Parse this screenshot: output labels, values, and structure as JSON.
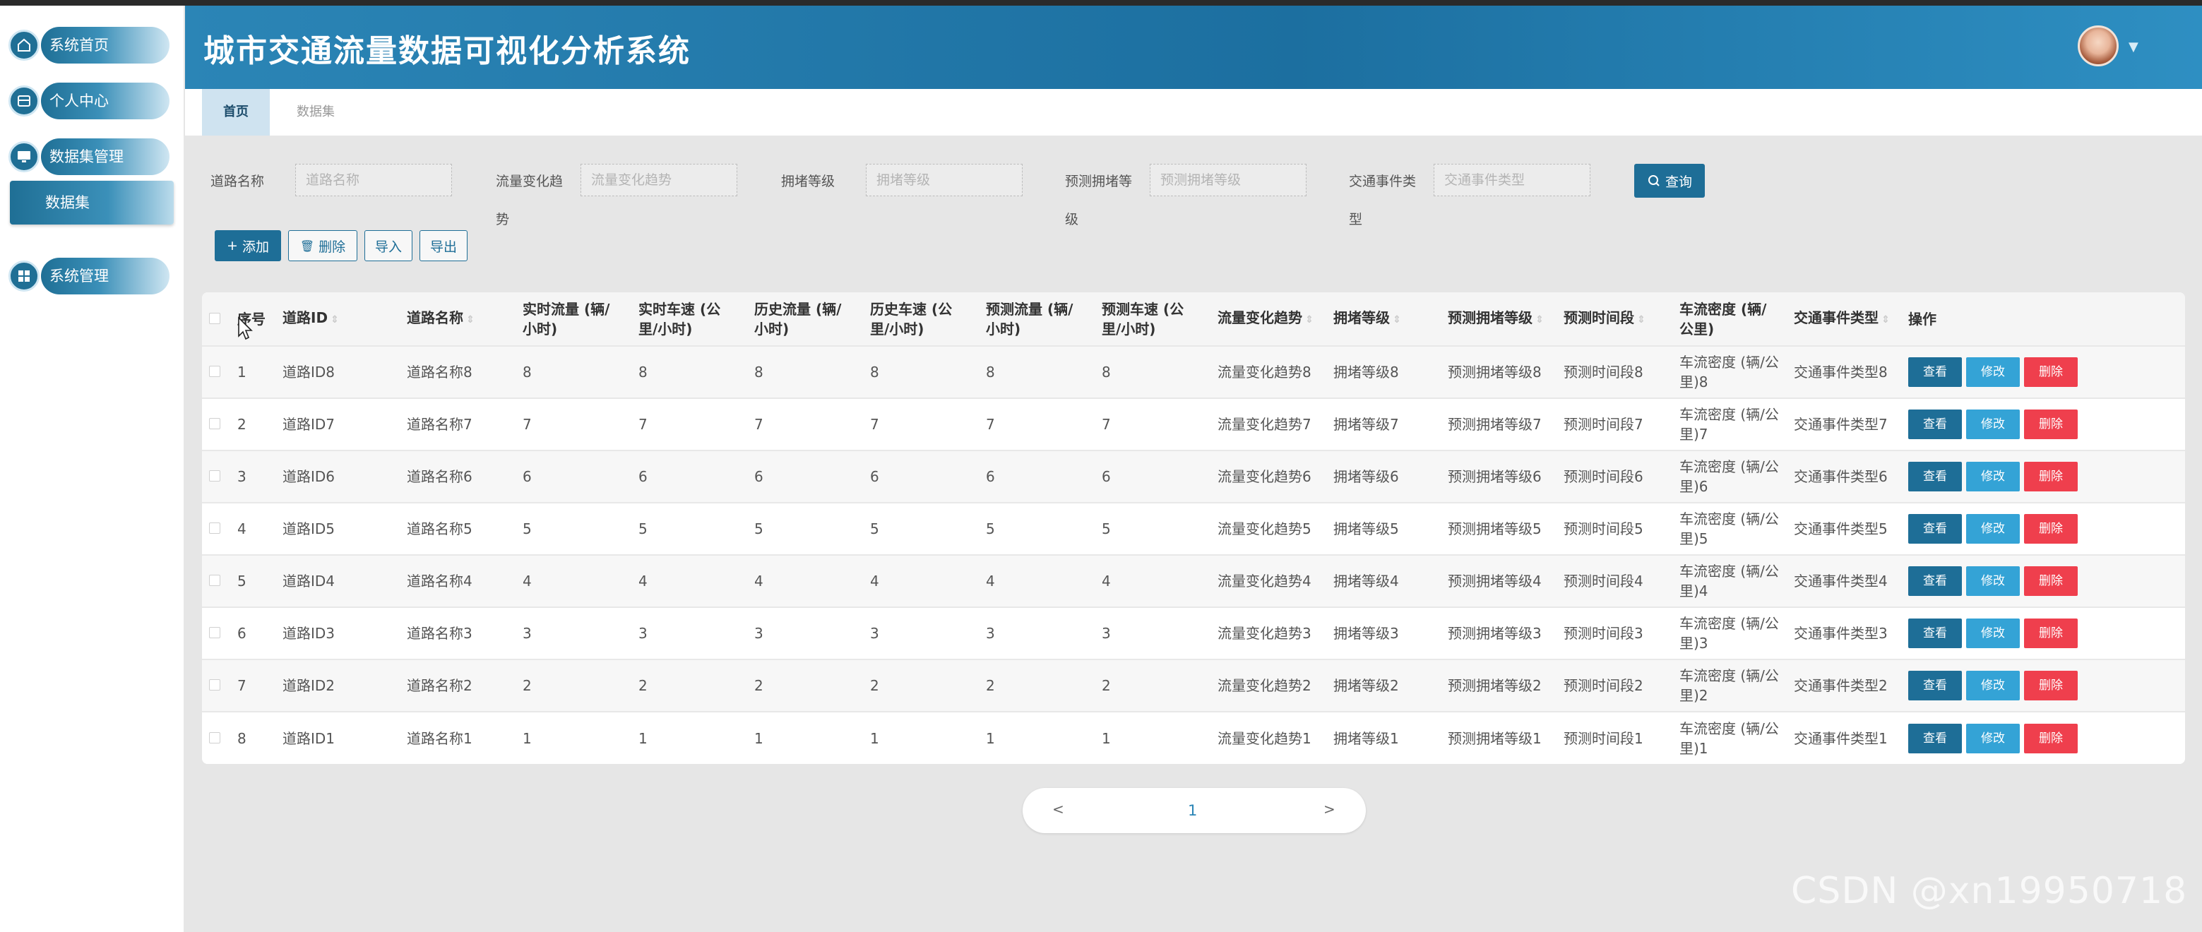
{
  "app": {
    "title": "城市交通流量数据可视化分析系统"
  },
  "sidebar": {
    "items": [
      {
        "label": "系统首页",
        "icon": "home-icon"
      },
      {
        "label": "个人中心",
        "icon": "profile-icon"
      },
      {
        "label": "数据集管理",
        "icon": "monitor-icon"
      },
      {
        "label": "系统管理",
        "icon": "grid-icon"
      }
    ],
    "sub_item": "数据集"
  },
  "tabs": [
    {
      "label": "首页",
      "active": true
    },
    {
      "label": "数据集",
      "active": false
    }
  ],
  "search": {
    "fields": [
      {
        "label_line1": "道路名称",
        "label_line2": "",
        "placeholder": "道路名称",
        "value": ""
      },
      {
        "label_line1": "流量变化趋",
        "label_line2": "势",
        "placeholder": "流量变化趋势",
        "value": ""
      },
      {
        "label_line1": "拥堵等级",
        "label_line2": "",
        "placeholder": "拥堵等级",
        "value": ""
      },
      {
        "label_line1": "预测拥堵等",
        "label_line2": "级",
        "placeholder": "预测拥堵等级",
        "value": ""
      },
      {
        "label_line1": "交通事件类",
        "label_line2": "型",
        "placeholder": "交通事件类型",
        "value": ""
      }
    ],
    "query_label": "查询"
  },
  "actions": {
    "add": "添加",
    "delete": "删除",
    "import": "导入",
    "export": "导出"
  },
  "table": {
    "columns": [
      {
        "line1": "序号",
        "line2": ""
      },
      {
        "line1": "道路ID",
        "line2": ""
      },
      {
        "line1": "道路名称",
        "line2": ""
      },
      {
        "line1": "实时流量 (辆/",
        "line2": "小时)"
      },
      {
        "line1": "实时车速 (公",
        "line2": "里/小时)"
      },
      {
        "line1": "历史流量 (辆/",
        "line2": "小时)"
      },
      {
        "line1": "历史车速 (公",
        "line2": "里/小时)"
      },
      {
        "line1": "预测流量 (辆/",
        "line2": "小时)"
      },
      {
        "line1": "预测车速 (公",
        "line2": "里/小时)"
      },
      {
        "line1": "流量变化趋势",
        "line2": ""
      },
      {
        "line1": "拥堵等级",
        "line2": ""
      },
      {
        "line1": "预测拥堵等级",
        "line2": ""
      },
      {
        "line1": "预测时间段",
        "line2": ""
      },
      {
        "line1": "车流密度 (辆/",
        "line2": "公里)"
      },
      {
        "line1": "交通事件类型",
        "line2": ""
      },
      {
        "line1": "操作",
        "line2": ""
      }
    ],
    "rows": [
      {
        "seq": "1",
        "road_id": "道路ID8",
        "road_name": "道路名称8",
        "rt_flow": "8",
        "rt_speed": "8",
        "hist_flow": "8",
        "hist_speed": "8",
        "pred_flow": "8",
        "pred_speed": "8",
        "trend": "流量变化趋势8",
        "congestion": "拥堵等级8",
        "pred_congestion": "预测拥堵等级8",
        "pred_period": "预测时间段8",
        "density_line1": "车流密度 (辆/公",
        "density_line2": "里)8",
        "event": "交通事件类型8"
      },
      {
        "seq": "2",
        "road_id": "道路ID7",
        "road_name": "道路名称7",
        "rt_flow": "7",
        "rt_speed": "7",
        "hist_flow": "7",
        "hist_speed": "7",
        "pred_flow": "7",
        "pred_speed": "7",
        "trend": "流量变化趋势7",
        "congestion": "拥堵等级7",
        "pred_congestion": "预测拥堵等级7",
        "pred_period": "预测时间段7",
        "density_line1": "车流密度 (辆/公",
        "density_line2": "里)7",
        "event": "交通事件类型7"
      },
      {
        "seq": "3",
        "road_id": "道路ID6",
        "road_name": "道路名称6",
        "rt_flow": "6",
        "rt_speed": "6",
        "hist_flow": "6",
        "hist_speed": "6",
        "pred_flow": "6",
        "pred_speed": "6",
        "trend": "流量变化趋势6",
        "congestion": "拥堵等级6",
        "pred_congestion": "预测拥堵等级6",
        "pred_period": "预测时间段6",
        "density_line1": "车流密度 (辆/公",
        "density_line2": "里)6",
        "event": "交通事件类型6"
      },
      {
        "seq": "4",
        "road_id": "道路ID5",
        "road_name": "道路名称5",
        "rt_flow": "5",
        "rt_speed": "5",
        "hist_flow": "5",
        "hist_speed": "5",
        "pred_flow": "5",
        "pred_speed": "5",
        "trend": "流量变化趋势5",
        "congestion": "拥堵等级5",
        "pred_congestion": "预测拥堵等级5",
        "pred_period": "预测时间段5",
        "density_line1": "车流密度 (辆/公",
        "density_line2": "里)5",
        "event": "交通事件类型5"
      },
      {
        "seq": "5",
        "road_id": "道路ID4",
        "road_name": "道路名称4",
        "rt_flow": "4",
        "rt_speed": "4",
        "hist_flow": "4",
        "hist_speed": "4",
        "pred_flow": "4",
        "pred_speed": "4",
        "trend": "流量变化趋势4",
        "congestion": "拥堵等级4",
        "pred_congestion": "预测拥堵等级4",
        "pred_period": "预测时间段4",
        "density_line1": "车流密度 (辆/公",
        "density_line2": "里)4",
        "event": "交通事件类型4"
      },
      {
        "seq": "6",
        "road_id": "道路ID3",
        "road_name": "道路名称3",
        "rt_flow": "3",
        "rt_speed": "3",
        "hist_flow": "3",
        "hist_speed": "3",
        "pred_flow": "3",
        "pred_speed": "3",
        "trend": "流量变化趋势3",
        "congestion": "拥堵等级3",
        "pred_congestion": "预测拥堵等级3",
        "pred_period": "预测时间段3",
        "density_line1": "车流密度 (辆/公",
        "density_line2": "里)3",
        "event": "交通事件类型3"
      },
      {
        "seq": "7",
        "road_id": "道路ID2",
        "road_name": "道路名称2",
        "rt_flow": "2",
        "rt_speed": "2",
        "hist_flow": "2",
        "hist_speed": "2",
        "pred_flow": "2",
        "pred_speed": "2",
        "trend": "流量变化趋势2",
        "congestion": "拥堵等级2",
        "pred_congestion": "预测拥堵等级2",
        "pred_period": "预测时间段2",
        "density_line1": "车流密度 (辆/公",
        "density_line2": "里)2",
        "event": "交通事件类型2"
      },
      {
        "seq": "8",
        "road_id": "道路ID1",
        "road_name": "道路名称1",
        "rt_flow": "1",
        "rt_speed": "1",
        "hist_flow": "1",
        "hist_speed": "1",
        "pred_flow": "1",
        "pred_speed": "1",
        "trend": "流量变化趋势1",
        "congestion": "拥堵等级1",
        "pred_congestion": "预测拥堵等级1",
        "pred_period": "预测时间段1",
        "density_line1": "车流密度 (辆/公",
        "density_line2": "里)1",
        "event": "交通事件类型1"
      }
    ],
    "row_actions": {
      "view": "查看",
      "edit": "修改",
      "delete": "删除"
    }
  },
  "pagination": {
    "prev": "<",
    "current": "1",
    "next": ">"
  },
  "watermark": "CSDN @xn19950718",
  "colors": {
    "primary": "#1e6e97",
    "accent": "#34a3d6",
    "danger": "#ef3f4d",
    "header": "#2b85b6"
  }
}
